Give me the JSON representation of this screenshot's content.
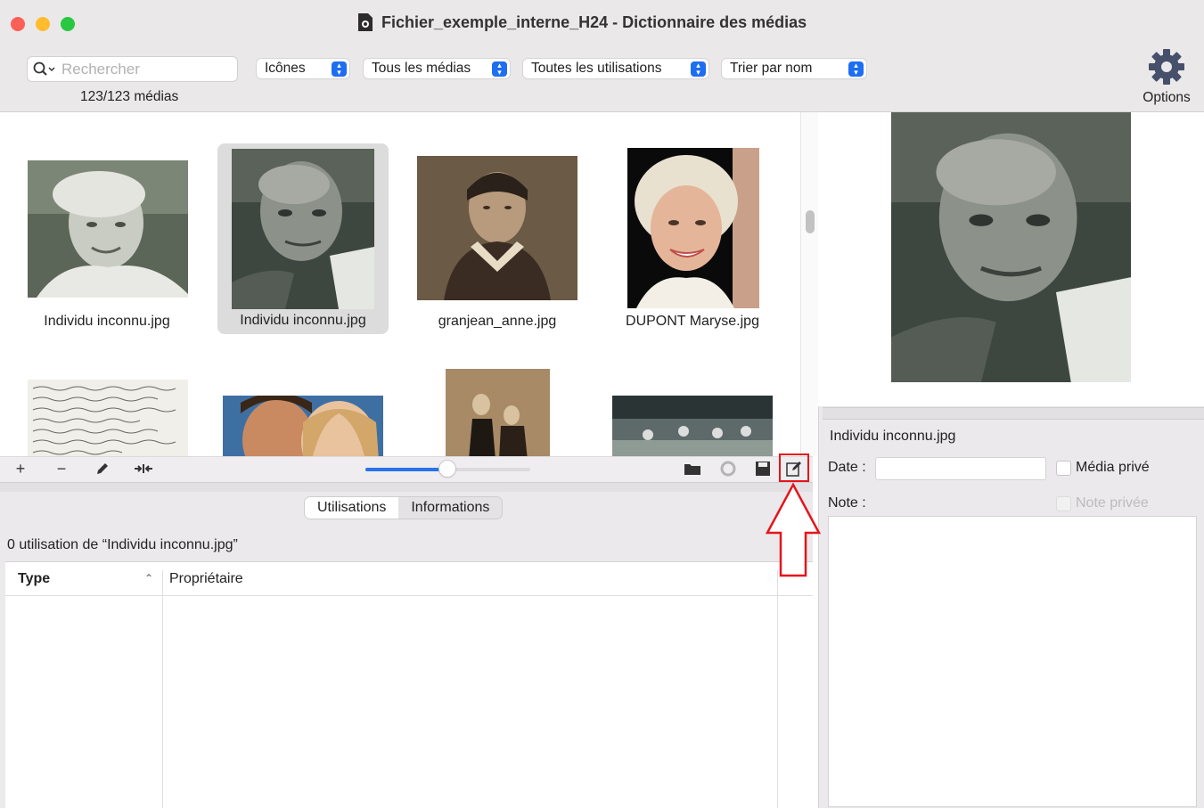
{
  "window": {
    "title": "Fichier_exemple_interne_H24 - Dictionnaire des médias"
  },
  "toolbar": {
    "search_placeholder": "Rechercher",
    "count": "123/123 médias",
    "view_popup": "Icônes",
    "media_filter_popup": "Tous les médias",
    "usage_filter_popup": "Toutes les utilisations",
    "sort_popup": "Trier par nom",
    "options_label": "Options"
  },
  "grid": {
    "items": [
      {
        "caption": "Individu inconnu.jpg"
      },
      {
        "caption": "Individu inconnu.jpg",
        "selected": true
      },
      {
        "caption": "granjean_anne.jpg"
      },
      {
        "caption": "DUPONT Maryse.jpg"
      }
    ],
    "zoom_level": 0.5
  },
  "bottom": {
    "tabs": [
      {
        "label": "Utilisations",
        "active": true
      },
      {
        "label": "Informations",
        "active": false
      }
    ],
    "usage_text": "0 utilisation de “Individu inconnu.jpg”",
    "columns": [
      "Type",
      "Propriétaire"
    ]
  },
  "details": {
    "filename": "Individu inconnu.jpg",
    "date_label": "Date :",
    "date_value": "",
    "private_media_label": "Média privé",
    "note_label": "Note :",
    "private_note_label": "Note privée",
    "note_value": ""
  },
  "colors": {
    "accent": "#1d6ef0",
    "annotation": "#e5141b"
  }
}
